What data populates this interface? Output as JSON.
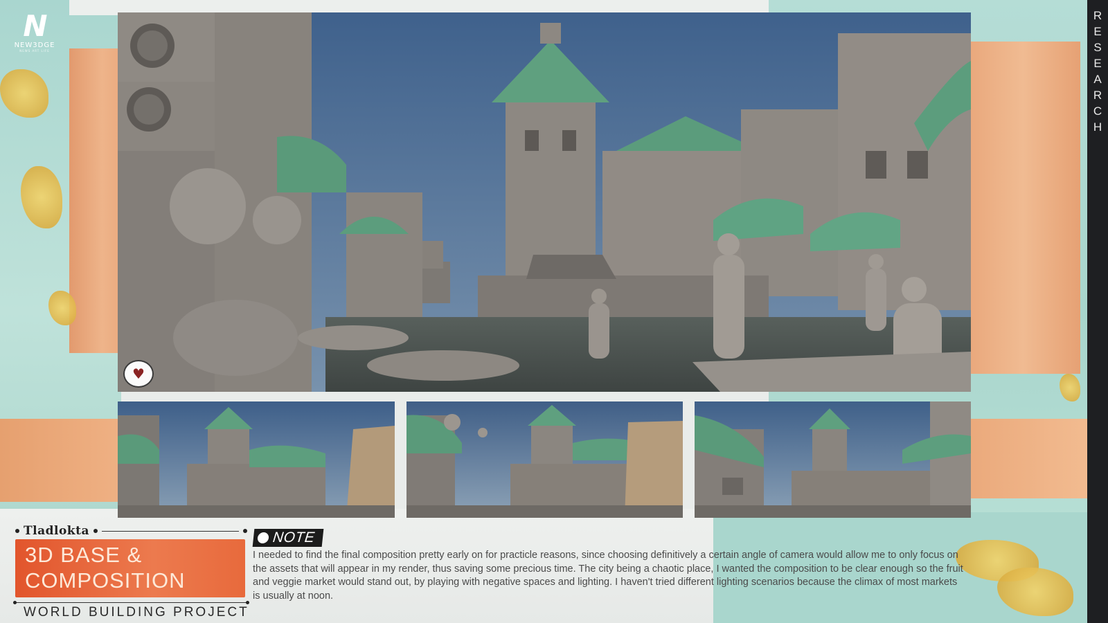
{
  "logo": {
    "mark": "N",
    "word": "NEW3DGE",
    "subtext": "NEWS ART LIFE"
  },
  "side_label": [
    "R",
    "E",
    "S",
    "E",
    "A",
    "R",
    "C",
    "H"
  ],
  "project": {
    "name": "Tladlokta",
    "title_line1": "3D BASE &",
    "title_line2": "COMPOSITION",
    "subtitle": "WORLD BUILDING PROJECT"
  },
  "note": {
    "label": "NOTE",
    "text": "I needed to find the final composition pretty early on for practicle reasons, since choosing definitively a certain angle of camera would allow me to only focus on the assets that will appear in my render, thus saving some precious time. The city being a chaotic place, I wanted the composition to be clear enough so the fruit and veggie market would stand out, by playing with negative spaces and lighting. I haven't tried different lighting scenarios because the climax of most markets is usually at noon."
  },
  "icons": {
    "heart": "heart-speech-bubble-icon",
    "note": "note-dot-icon"
  },
  "colors": {
    "sky": "#4e6f95",
    "clay": "#8c8680",
    "roof_green": "#5c9e7e",
    "title_orange": "#e8643a",
    "mint": "#a9d6cd"
  }
}
